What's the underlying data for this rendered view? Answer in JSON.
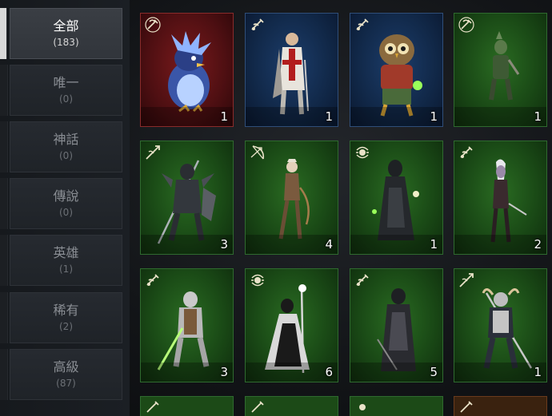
{
  "sidebar": {
    "items": [
      {
        "label": "全部",
        "count": "(183)",
        "active": true
      },
      {
        "label": "唯一",
        "count": "(0)"
      },
      {
        "label": "神話",
        "count": "(0)"
      },
      {
        "label": "傳說",
        "count": "(0)"
      },
      {
        "label": "英雄",
        "count": "(1)"
      },
      {
        "label": "稀有",
        "count": "(2)"
      },
      {
        "label": "高級",
        "count": "(87)"
      }
    ]
  },
  "cards": [
    {
      "name": "penguin-spirit",
      "rarity": "red",
      "class_icon": "dagger-class-icon",
      "count": "1"
    },
    {
      "name": "crusader-knight",
      "rarity": "blue",
      "class_icon": "sword-class-icon",
      "count": "1"
    },
    {
      "name": "owl-warrior",
      "rarity": "blue",
      "class_icon": "sword-class-icon",
      "count": "1"
    },
    {
      "name": "goblin-scout",
      "rarity": "green",
      "class_icon": "dagger-class-icon",
      "count": "1"
    },
    {
      "name": "dark-knight-spear",
      "rarity": "green",
      "class_icon": "spear-class-icon",
      "count": "3"
    },
    {
      "name": "elf-archer",
      "rarity": "green",
      "class_icon": "bow-class-icon",
      "count": "4"
    },
    {
      "name": "robed-mage",
      "rarity": "green",
      "class_icon": "orb-class-icon",
      "count": "1"
    },
    {
      "name": "dark-elf-rogue",
      "rarity": "green",
      "class_icon": "sword-class-icon",
      "count": "2"
    },
    {
      "name": "armored-swordsman",
      "rarity": "green",
      "class_icon": "sword-class-icon",
      "count": "3"
    },
    {
      "name": "staff-priestess",
      "rarity": "green",
      "class_icon": "orb-class-icon",
      "count": "6"
    },
    {
      "name": "dark-robed-knight",
      "rarity": "green",
      "class_icon": "sword-class-icon",
      "count": "5"
    },
    {
      "name": "horned-lancer",
      "rarity": "green",
      "class_icon": "spear-class-icon",
      "count": "1"
    }
  ],
  "colors": {
    "active_rail": "#d8d8d8",
    "green_card": "#1a4a16",
    "red_card": "#4e0f12",
    "blue_card": "#112848"
  }
}
